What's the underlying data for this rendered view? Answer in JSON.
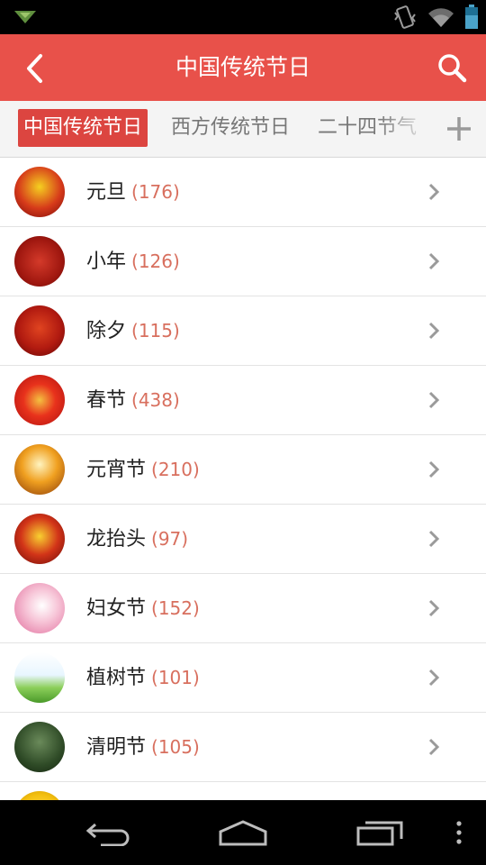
{
  "status_bar": {
    "icons": [
      "notification-icon",
      "vibrate-icon",
      "wifi-icon",
      "battery-icon"
    ]
  },
  "app_bar": {
    "title": "中国传统节日",
    "back_icon": "back-chevron-icon",
    "search_icon": "search-icon",
    "background": "#e8514a"
  },
  "tabs": {
    "items": [
      {
        "label": "中国传统节日",
        "active": true
      },
      {
        "label": "西方传统节日",
        "active": false
      },
      {
        "label": "二十四节气",
        "active": false
      }
    ],
    "add_icon": "plus-icon",
    "active_color": "#dc4540"
  },
  "list": {
    "items": [
      {
        "name": "元旦",
        "count": "(176)"
      },
      {
        "name": "小年",
        "count": "(126)"
      },
      {
        "name": "除夕",
        "count": "(115)"
      },
      {
        "name": "春节",
        "count": "(438)"
      },
      {
        "name": "元宵节",
        "count": "(210)"
      },
      {
        "name": "龙抬头",
        "count": "(97)"
      },
      {
        "name": "妇女节",
        "count": "(152)"
      },
      {
        "name": "植树节",
        "count": "(101)"
      },
      {
        "name": "清明节",
        "count": "(105)"
      }
    ],
    "count_color": "#d86f5e",
    "row_icon": "chevron-right-icon"
  },
  "nav_bar": {
    "icons": [
      "back-nav-icon",
      "home-nav-icon",
      "recents-nav-icon",
      "menu-nav-icon"
    ]
  }
}
